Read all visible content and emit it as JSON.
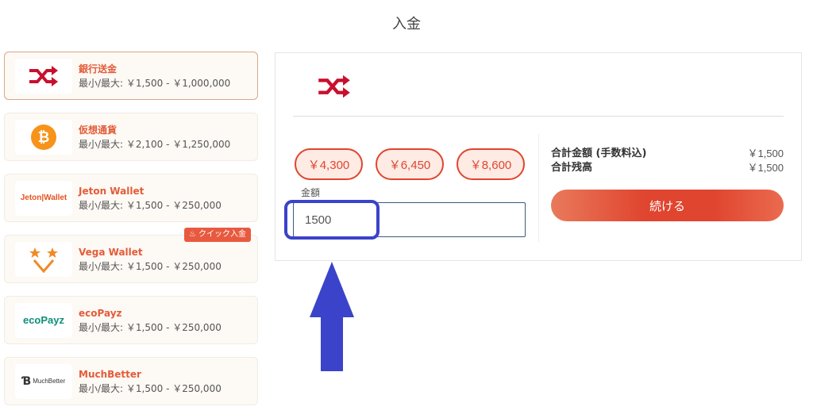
{
  "page": {
    "title": "入金"
  },
  "methods": [
    {
      "name": "銀行送金",
      "range": "最小/最大: ￥1,500 - ￥1,000,000",
      "logo": "shuffle-arrows-icon",
      "selected": true
    },
    {
      "name": "仮想通貨",
      "range": "最小/最大: ￥2,100 - ￥1,250,000",
      "logo": "bitcoin-icon"
    },
    {
      "name": "Jeton Wallet",
      "range": "最小/最大: ￥1,500 - ￥250,000",
      "logo": "jeton-wallet-logo",
      "logo_text": "Jeton|Wallet"
    },
    {
      "name": "Vega Wallet",
      "range": "最小/最大: ￥1,500 - ￥250,000",
      "logo": "vega-wallet-logo",
      "badge": "クイック入金"
    },
    {
      "name": "ecoPayz",
      "range": "最小/最大: ￥1,500 - ￥250,000",
      "logo": "ecopayz-logo",
      "logo_text": "ecoPayz"
    },
    {
      "name": "MuchBetter",
      "range": "最小/最大: ￥1,500 - ￥250,000",
      "logo": "muchbetter-logo",
      "logo_text": "MuchBetter"
    }
  ],
  "deposit": {
    "presets": [
      "￥4,300",
      "￥6,450",
      "￥8,600"
    ],
    "amount_label": "金額",
    "amount_value": "1500",
    "total_label": "合計金額 (手数料込)",
    "total_value": "￥1,500",
    "balance_label": "合計残高",
    "balance_value": "￥1,500",
    "continue_label": "続ける"
  },
  "colors": {
    "accent": "#e0452f",
    "annotation": "#3a43c9"
  }
}
